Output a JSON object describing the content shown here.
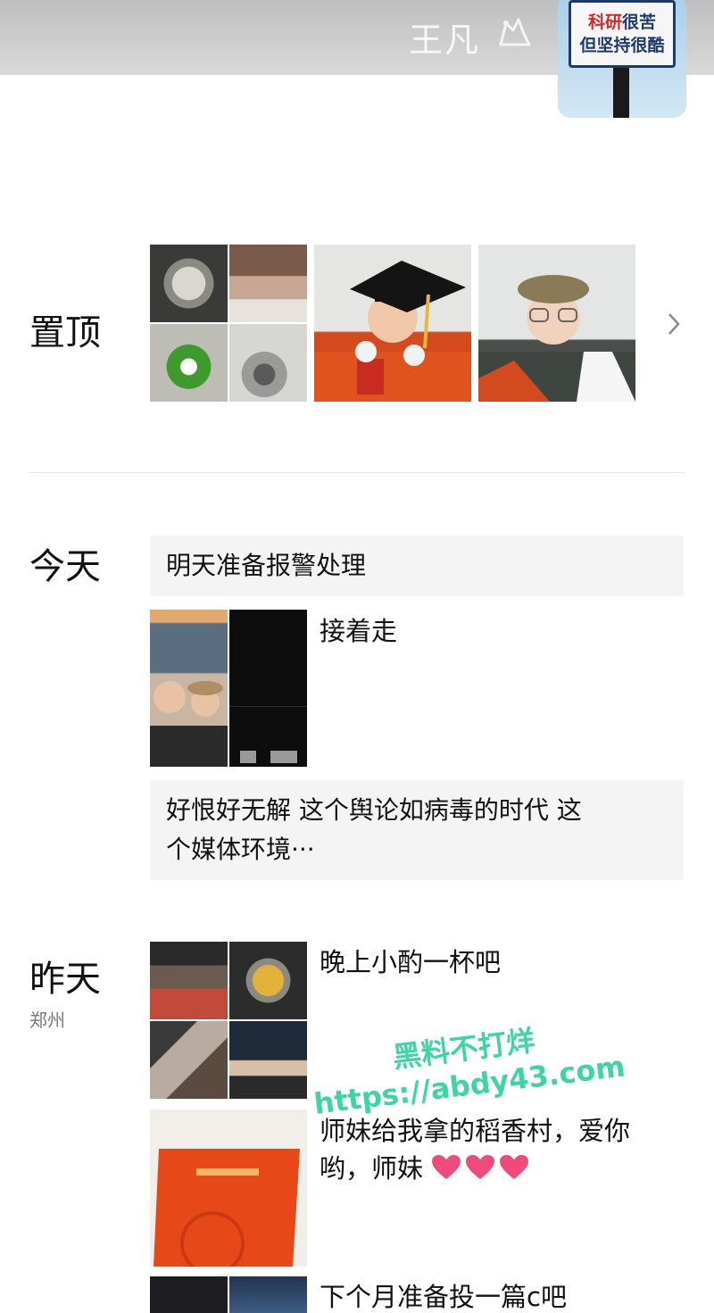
{
  "header": {
    "username": "王凡",
    "avatar_sign_line1_red": "科研",
    "avatar_sign_line1_rest": "很苦",
    "avatar_sign_line2": "但坚持很酷"
  },
  "pinned": {
    "label": "置顶"
  },
  "today": {
    "label": "今天",
    "text_post_1": "明天准备报警处理",
    "photo_post_caption": "接着走",
    "text_post_2_line1": "好恨好无解 这个舆论如病毒的时代 这",
    "text_post_2_line2": "个媒体环境···"
  },
  "yesterday": {
    "label": "昨天",
    "location": "郑州",
    "post1_caption": "晚上小酌一杯吧",
    "post2_caption_line1": "师妹给我拿的稻香村，爱你",
    "post2_caption_line2": "哟，师妹",
    "post3_caption": "下个月准备投一篇c吧"
  },
  "watermark": {
    "line1": "黑料不打烊",
    "line2": "https://abdy43.com"
  },
  "colors": {
    "header_bg": "#c8c8c8",
    "text_post_bg": "#f4f4f4",
    "watermark": "#3fd4a6",
    "heart": "#f04a7c"
  }
}
